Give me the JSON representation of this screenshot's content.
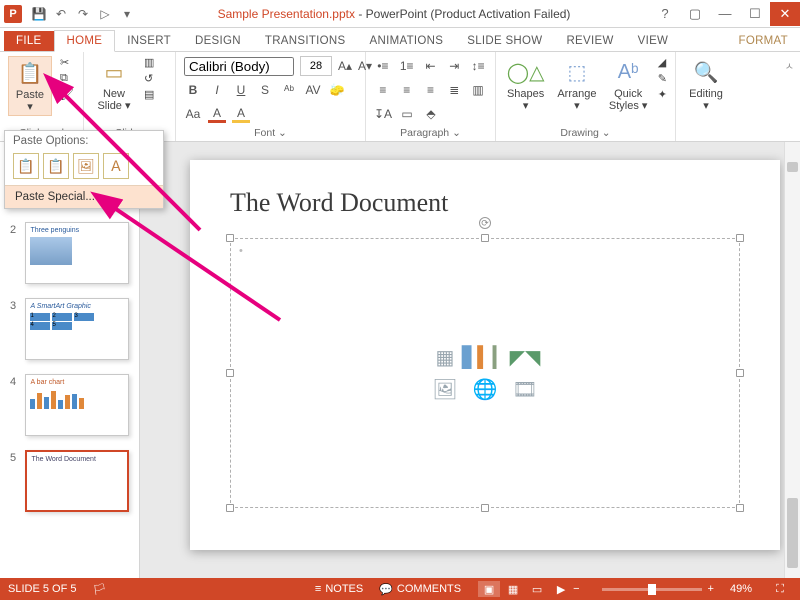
{
  "window": {
    "filename": "Sample Presentation.pptx",
    "app_title": " -  PowerPoint (Product Activation Failed)",
    "help": "?",
    "qat": {
      "save": "💾",
      "undo": "↶",
      "redo": "↷",
      "start": "▷",
      "more": "▾"
    }
  },
  "tabs": {
    "file": "FILE",
    "home": "HOME",
    "insert": "INSERT",
    "design": "DESIGN",
    "transitions": "TRANSITIONS",
    "animations": "ANIMATIONS",
    "slideshow": "SLIDE SHOW",
    "review": "REVIEW",
    "view": "VIEW",
    "format": "FORMAT"
  },
  "ribbon": {
    "clipboard": {
      "paste": "Paste",
      "label": "Clipboard"
    },
    "slides": {
      "newslide_l1": "New",
      "newslide_l2": "Slide",
      "label": "Slides"
    },
    "font": {
      "name": "Calibri (Body)",
      "size": "28",
      "label": "Font"
    },
    "paragraph": {
      "label": "Paragraph"
    },
    "drawing": {
      "shapes": "Shapes",
      "arrange": "Arrange",
      "quick_l1": "Quick",
      "quick_l2": "Styles",
      "label": "Drawing"
    },
    "editing": {
      "label": "Editing"
    }
  },
  "paste_dd": {
    "header": "Paste Options:",
    "special": "Paste Special..."
  },
  "thumbs": [
    {
      "n": "2",
      "title": "Three penguins"
    },
    {
      "n": "3",
      "title": "A SmartArt Graphic"
    },
    {
      "n": "4",
      "title": "A bar chart"
    },
    {
      "n": "5",
      "title": "The Word Document"
    }
  ],
  "slide": {
    "title": "The Word Document"
  },
  "status": {
    "slide": "SLIDE 5 OF 5",
    "lang_icon": "🏳",
    "notes": "NOTES",
    "comments": "COMMENTS",
    "zoom_out": "−",
    "zoom_in": "+",
    "zoom_pct": "49%"
  }
}
